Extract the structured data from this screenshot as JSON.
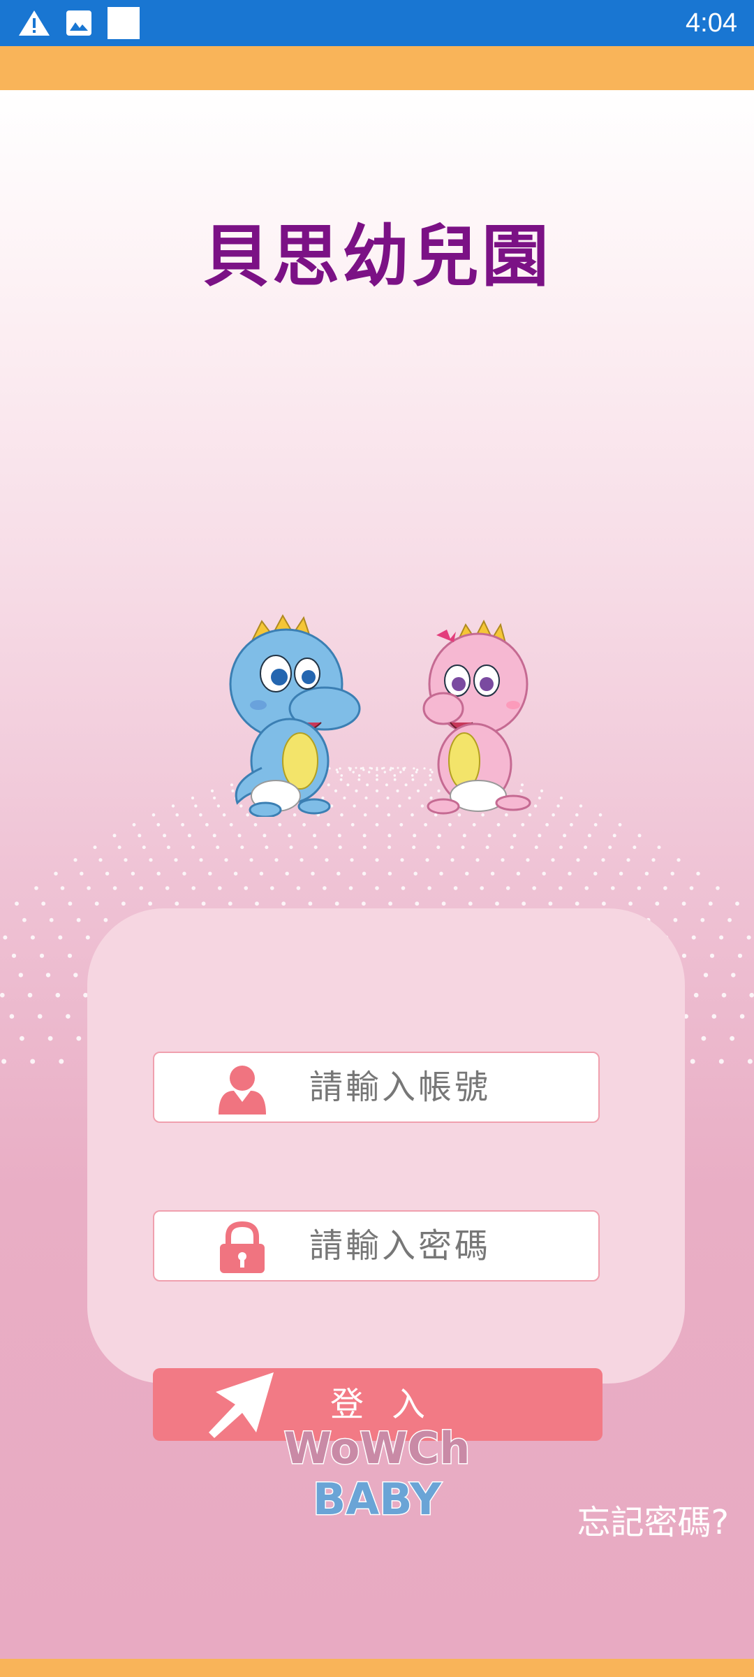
{
  "status_bar": {
    "time": "4:04",
    "icons": [
      "warning-icon",
      "image-icon",
      "blank-square-icon"
    ]
  },
  "school": {
    "title": "貝思幼兒園"
  },
  "login_form": {
    "account_placeholder": "請輸入帳號",
    "password_placeholder": "請輸入密碼",
    "login_label": "登入"
  },
  "brand": {
    "line1": "WoWCh",
    "line2": "BABY"
  },
  "forgot_password": "忘記密碼?",
  "colors": {
    "status_bar": "#1976d2",
    "accent_orange": "#f9b459",
    "title_purple": "#7b1185",
    "button_pink": "#f27a85",
    "icon_pink": "#f07480"
  }
}
